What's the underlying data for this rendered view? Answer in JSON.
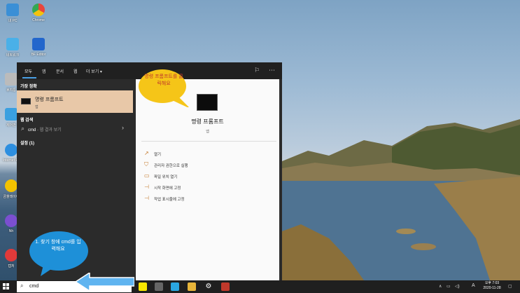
{
  "desktop": {
    "icons": [
      {
        "label": "내 PC",
        "name": "my-pc",
        "color": "#3a8fd6"
      },
      {
        "label": "Chrome",
        "name": "chrome",
        "color": "#e8453c"
      },
      {
        "label": "네트워크",
        "name": "network",
        "color": "#4ab0e8"
      },
      {
        "label": "BF Editor",
        "name": "bm-app",
        "color": "#2266cc"
      },
      {
        "label": "휴지통",
        "name": "recycle-bin",
        "color": "#bbbbbb"
      },
      {
        "label": "제어판",
        "name": "control-panel",
        "color": "#3aa0e0"
      },
      {
        "label": "Internet Explorer",
        "name": "internet-explorer",
        "color": "#2d8fe0"
      },
      {
        "label": "곰플레이어",
        "name": "player",
        "color": "#f2c200"
      },
      {
        "label": "Nh",
        "name": "n-app",
        "color": "#7b4fd0"
      },
      {
        "label": "캡처",
        "name": "capture",
        "color": "#e03a3a"
      }
    ]
  },
  "start_menu": {
    "tabs": [
      "모두",
      "앱",
      "문서",
      "웹",
      "더 보기"
    ],
    "best_match_heading": "가장 정확",
    "best_match": {
      "title": "명령 프롬프트",
      "type": "앱"
    },
    "web_heading": "웹 검색",
    "web_query": "cmd",
    "web_query_suffix": " - 웹 결과 보기",
    "settings_heading": "설정 (1)",
    "detail": {
      "title": "명령 프롬프트",
      "type": "앱",
      "actions": [
        "열기",
        "관리자 권한으로 실행",
        "파일 위치 열기",
        "시작 화면에 고정",
        "작업 표시줄에 고정"
      ]
    }
  },
  "taskbar": {
    "search_value": "cmd",
    "clock_ampm_time": "오후 7:03",
    "clock_date": "2020-11-28",
    "ime_label": "A"
  },
  "annotations": {
    "yellow_bubble": "명령 프롬프트를 클릭해요",
    "blue_bubble": "1. 찾기 창에 cmd를 입력해요"
  },
  "colors": {
    "best_match_bg": "#e8c8a8",
    "accent_blue": "#4aa0e6",
    "bubble_yellow": "#f5c518",
    "bubble_blue": "#1e90d8"
  }
}
